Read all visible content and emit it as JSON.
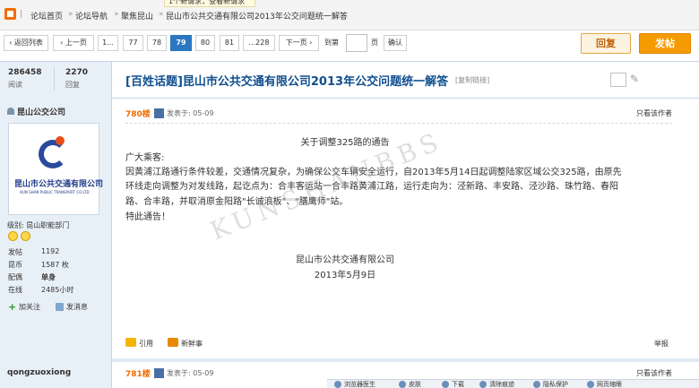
{
  "breadcrumb": {
    "items": [
      "论坛首页",
      "论坛导航",
      "聚焦昆山",
      "昆山市公共交通有限公司2013年公交问题统一解答"
    ],
    "notice": "1个新请求，查看新请求"
  },
  "pager": {
    "back_label": "返回列表",
    "prev_label": "上一页",
    "first": "1...",
    "pages": [
      "77",
      "78",
      "79",
      "80",
      "81"
    ],
    "current": "79",
    "last": "...228",
    "next_label": "下一页",
    "goto_label": "到第",
    "goto_value": "",
    "page_suffix": "页",
    "confirm_label": "确认"
  },
  "actions": {
    "reply": "回复",
    "post": "发帖"
  },
  "stats": {
    "views": "286458",
    "views_label": "阅读",
    "replies": "2270",
    "replies_label": "回复"
  },
  "thread": {
    "title": "[百姓话题]昆山市公共交通有限公司2013年公交问题统一解答",
    "copy_link": "[复制链接]"
  },
  "author": {
    "name": "昆山公交公司",
    "logo_text": "昆山市公共交通有限公司",
    "logo_subtext": "KUN SHAN PUBLIC TRANSPORT CO.LTD",
    "level": "级别: 昆山职能部门",
    "profile": [
      {
        "k": "发帖",
        "v": "1192"
      },
      {
        "k": "昆币",
        "v": "1587 枚"
      },
      {
        "k": "配偶",
        "v": "单身"
      },
      {
        "k": "在线",
        "v": "2485小时"
      }
    ],
    "follow": "加关注",
    "message": "发消息"
  },
  "post": {
    "floor": "780楼",
    "posted": "发表于: 05-09",
    "only_author": "只看该作者",
    "notice_title": "关于调整325路的通告",
    "lines": [
      "广大乘客:",
      "因黄浦江路通行条件较差，交通情况复杂，为确保公交车辆安全运行，自2013年5月14日起调整陆家区域公交325路，由原先",
      "环线走向调整为对发线路，起讫点为：合丰客运站一合丰路黄浦江路，运行走向为：泾新路、丰安路、泾沙路、珠竹路、春阳",
      "路、合丰路，并取消原金阳路\"长诚浪板\"、\"膳鹰师\"站。",
      "特此通告！"
    ],
    "sign_org": "昆山市公共交通有限公司",
    "sign_date": "2013年5月9日",
    "watermark": "KUNSHANBBS",
    "quote": "引用",
    "fresh": "新鲜事",
    "report": "举报"
  },
  "next_post": {
    "user": "qongzuoxiong",
    "floor": "781楼",
    "posted": "发表于: 05-09",
    "only_author": "只看该作者"
  },
  "statusbar": {
    "items": [
      "浏览器医生",
      "皮肤",
      "下载",
      "清除痕迹",
      "隐私保护",
      "网页缩眼"
    ]
  },
  "colors": {
    "accent": "#f59a00",
    "link": "#104f8f",
    "current_page": "#2b77c1",
    "floor": "#f26c00"
  }
}
